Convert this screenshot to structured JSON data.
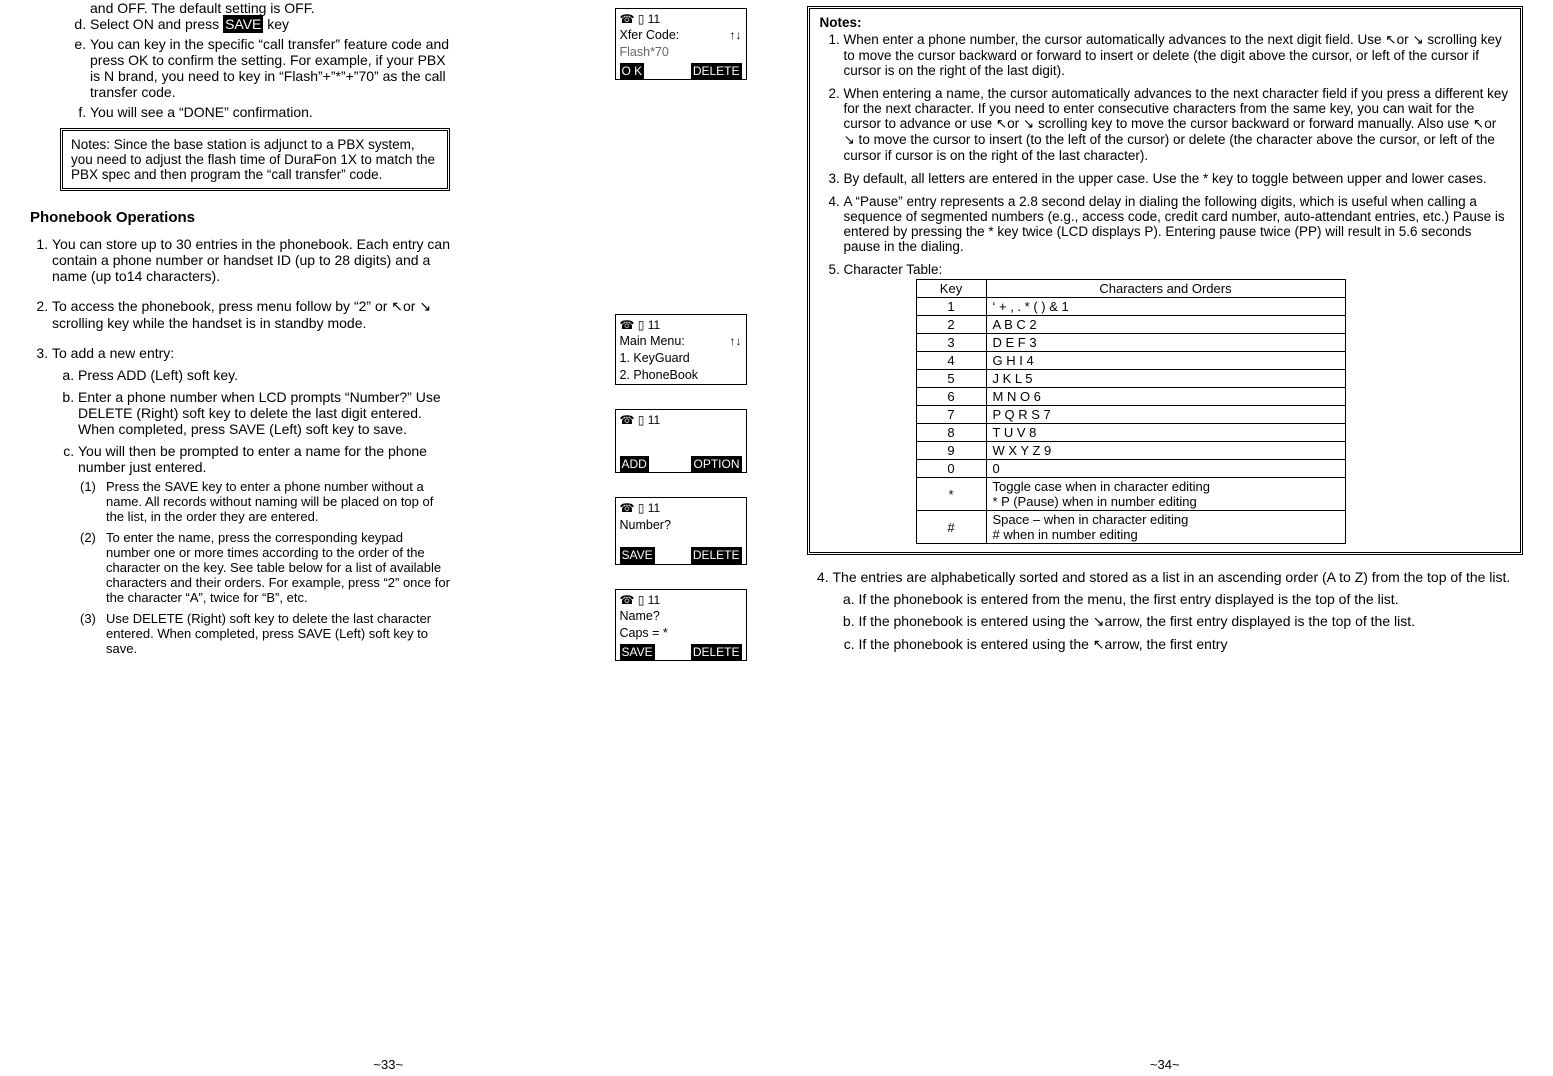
{
  "leftPage": {
    "preItems": {
      "offTail": "and OFF. The default setting is OFF.",
      "d": {
        "prefix": "Select ON and press ",
        "saveChip": "SAVE",
        "suffix": " key"
      },
      "e": "You can key in the specific “call transfer” feature code and press OK to confirm the setting. For example, if your PBX is N brand, you need to key in “Flash”+”*”+”70” as the call transfer code.",
      "f": "You will see a “DONE” confirmation."
    },
    "notesBox": "Notes:  Since the base station is adjunct to a PBX system, you need to adjust the flash time of DuraFon 1X  to match the PBX spec and then program the “call transfer” code.",
    "sectionTitle": "Phonebook Operations",
    "num1": "You can store up to 30 entries in the phonebook.  Each entry can contain a phone number or handset ID (up to 28 digits) and a name (up to14 characters).",
    "num2": "To access the phonebook, press menu follow by “2” or ↖or ↘ scrolling key while the handset is in standby mode.",
    "num3": {
      "lead": "To add a new entry:",
      "a": "Press ADD (Left) soft key.",
      "b": "Enter a phone number when LCD prompts “Number?”   Use DELETE (Right) soft key to delete the last digit entered.  When completed, press SAVE (Left) soft key to save.",
      "c": {
        "lead": "You will then be prompted to enter a name for the phone number just entered.",
        "p1": "Press the SAVE key to enter a phone number without a name.  All records without naming will be placed on top of the list, in the order they are entered.",
        "p2": "To enter the name, press the corresponding keypad number one or more times according to the order of the character on the key.  See table below for a list of available characters and their orders.  For example, press “2” once for the character “A”, twice for “B”, etc.",
        "p3": "Use DELETE (Right) soft key to delete the last character entered.  When completed, press SAVE (Left) soft key to save."
      }
    },
    "pageNum": "~33~",
    "lcd": {
      "top": {
        "iconrow": "☎ ▯ 11",
        "l1": "Xfer Code:",
        "arrows": "↑↓",
        "l2": "Flash*70",
        "skL": "O K",
        "skR": "DELETE"
      },
      "main": {
        "iconrow": "☎ ▯ 11",
        "l1": "Main Menu:",
        "arrows": "↑↓",
        "l2": "1. KeyGuard",
        "l3": "2. PhoneBook"
      },
      "addopt": {
        "iconrow": "☎ ▯ 11",
        "skL": "ADD",
        "skR": "OPTION"
      },
      "number": {
        "iconrow": "☎ ▯ 11",
        "l1": "Number?",
        "skL": "SAVE",
        "skR": "DELETE"
      },
      "name": {
        "iconrow": "☎ ▯ 11",
        "l1": "Name?",
        "l2": "Caps = *",
        "skL": "SAVE",
        "skR": "DELETE"
      }
    }
  },
  "rightPage": {
    "notesHdr": "Notes:",
    "notesItems": [
      "When enter a phone number, the cursor automatically advances to the next digit field.  Use ↖or ↘ scrolling key to move the cursor backward or forward to insert or delete (the digit above the cursor, or left of the cursor if cursor is on the right of the last digit).",
      "When entering a name, the cursor automatically advances to the next character field if you press a different key for the next character.  If you need to enter consecutive characters from the same key, you can wait for the cursor to advance or use ↖or ↘ scrolling key to move the cursor backward or forward manually.  Also use ↖or ↘ to move the cursor to insert (to the left of the cursor) or delete (the character above the cursor, or left of the cursor if cursor is on the right of the last character).",
      "By default, all letters are entered in the upper case.  Use the * key to toggle between upper and lower cases.",
      "A “Pause” entry represents a 2.8 second delay in dialing the following digits, which is useful when calling a sequence of segmented numbers (e.g., access code, credit card number, auto-attendant entries, etc.)  Pause is entered by pressing the * key twice (LCD displays P).  Entering pause twice (PP) will result in 5.6 seconds pause in the dialing.",
      "Character Table:"
    ],
    "charTable": {
      "headers": [
        "Key",
        "Characters and Orders"
      ],
      "rows": [
        [
          "1",
          "‘ + , . * ( ) & 1"
        ],
        [
          "2",
          "A B C 2"
        ],
        [
          "3",
          "D E F 3"
        ],
        [
          "4",
          "G H I 4"
        ],
        [
          "5",
          "J K L 5"
        ],
        [
          "6",
          "M N O 6"
        ],
        [
          "7",
          "P Q R S 7"
        ],
        [
          "8",
          "T U V 8"
        ],
        [
          "9",
          "W X Y Z 9"
        ],
        [
          "0",
          "0"
        ],
        [
          "*",
          "Toggle case when in character editing\n* P (Pause) when in number editing"
        ],
        [
          "#",
          "Space – when in character editing\n# when in number editing"
        ]
      ]
    },
    "afterNotes": {
      "n4lead": "The entries are alphabetically sorted and stored as a list in an ascending order (A to Z) from the top of the list.",
      "a": "If the phonebook is entered from the menu, the first entry displayed is the top of the list.",
      "b": "If the phonebook is entered using the ↘arrow, the first entry displayed is the top of the list.",
      "c": "If the phonebook is entered using the ↖arrow, the first entry"
    },
    "pageNum": "~34~"
  }
}
